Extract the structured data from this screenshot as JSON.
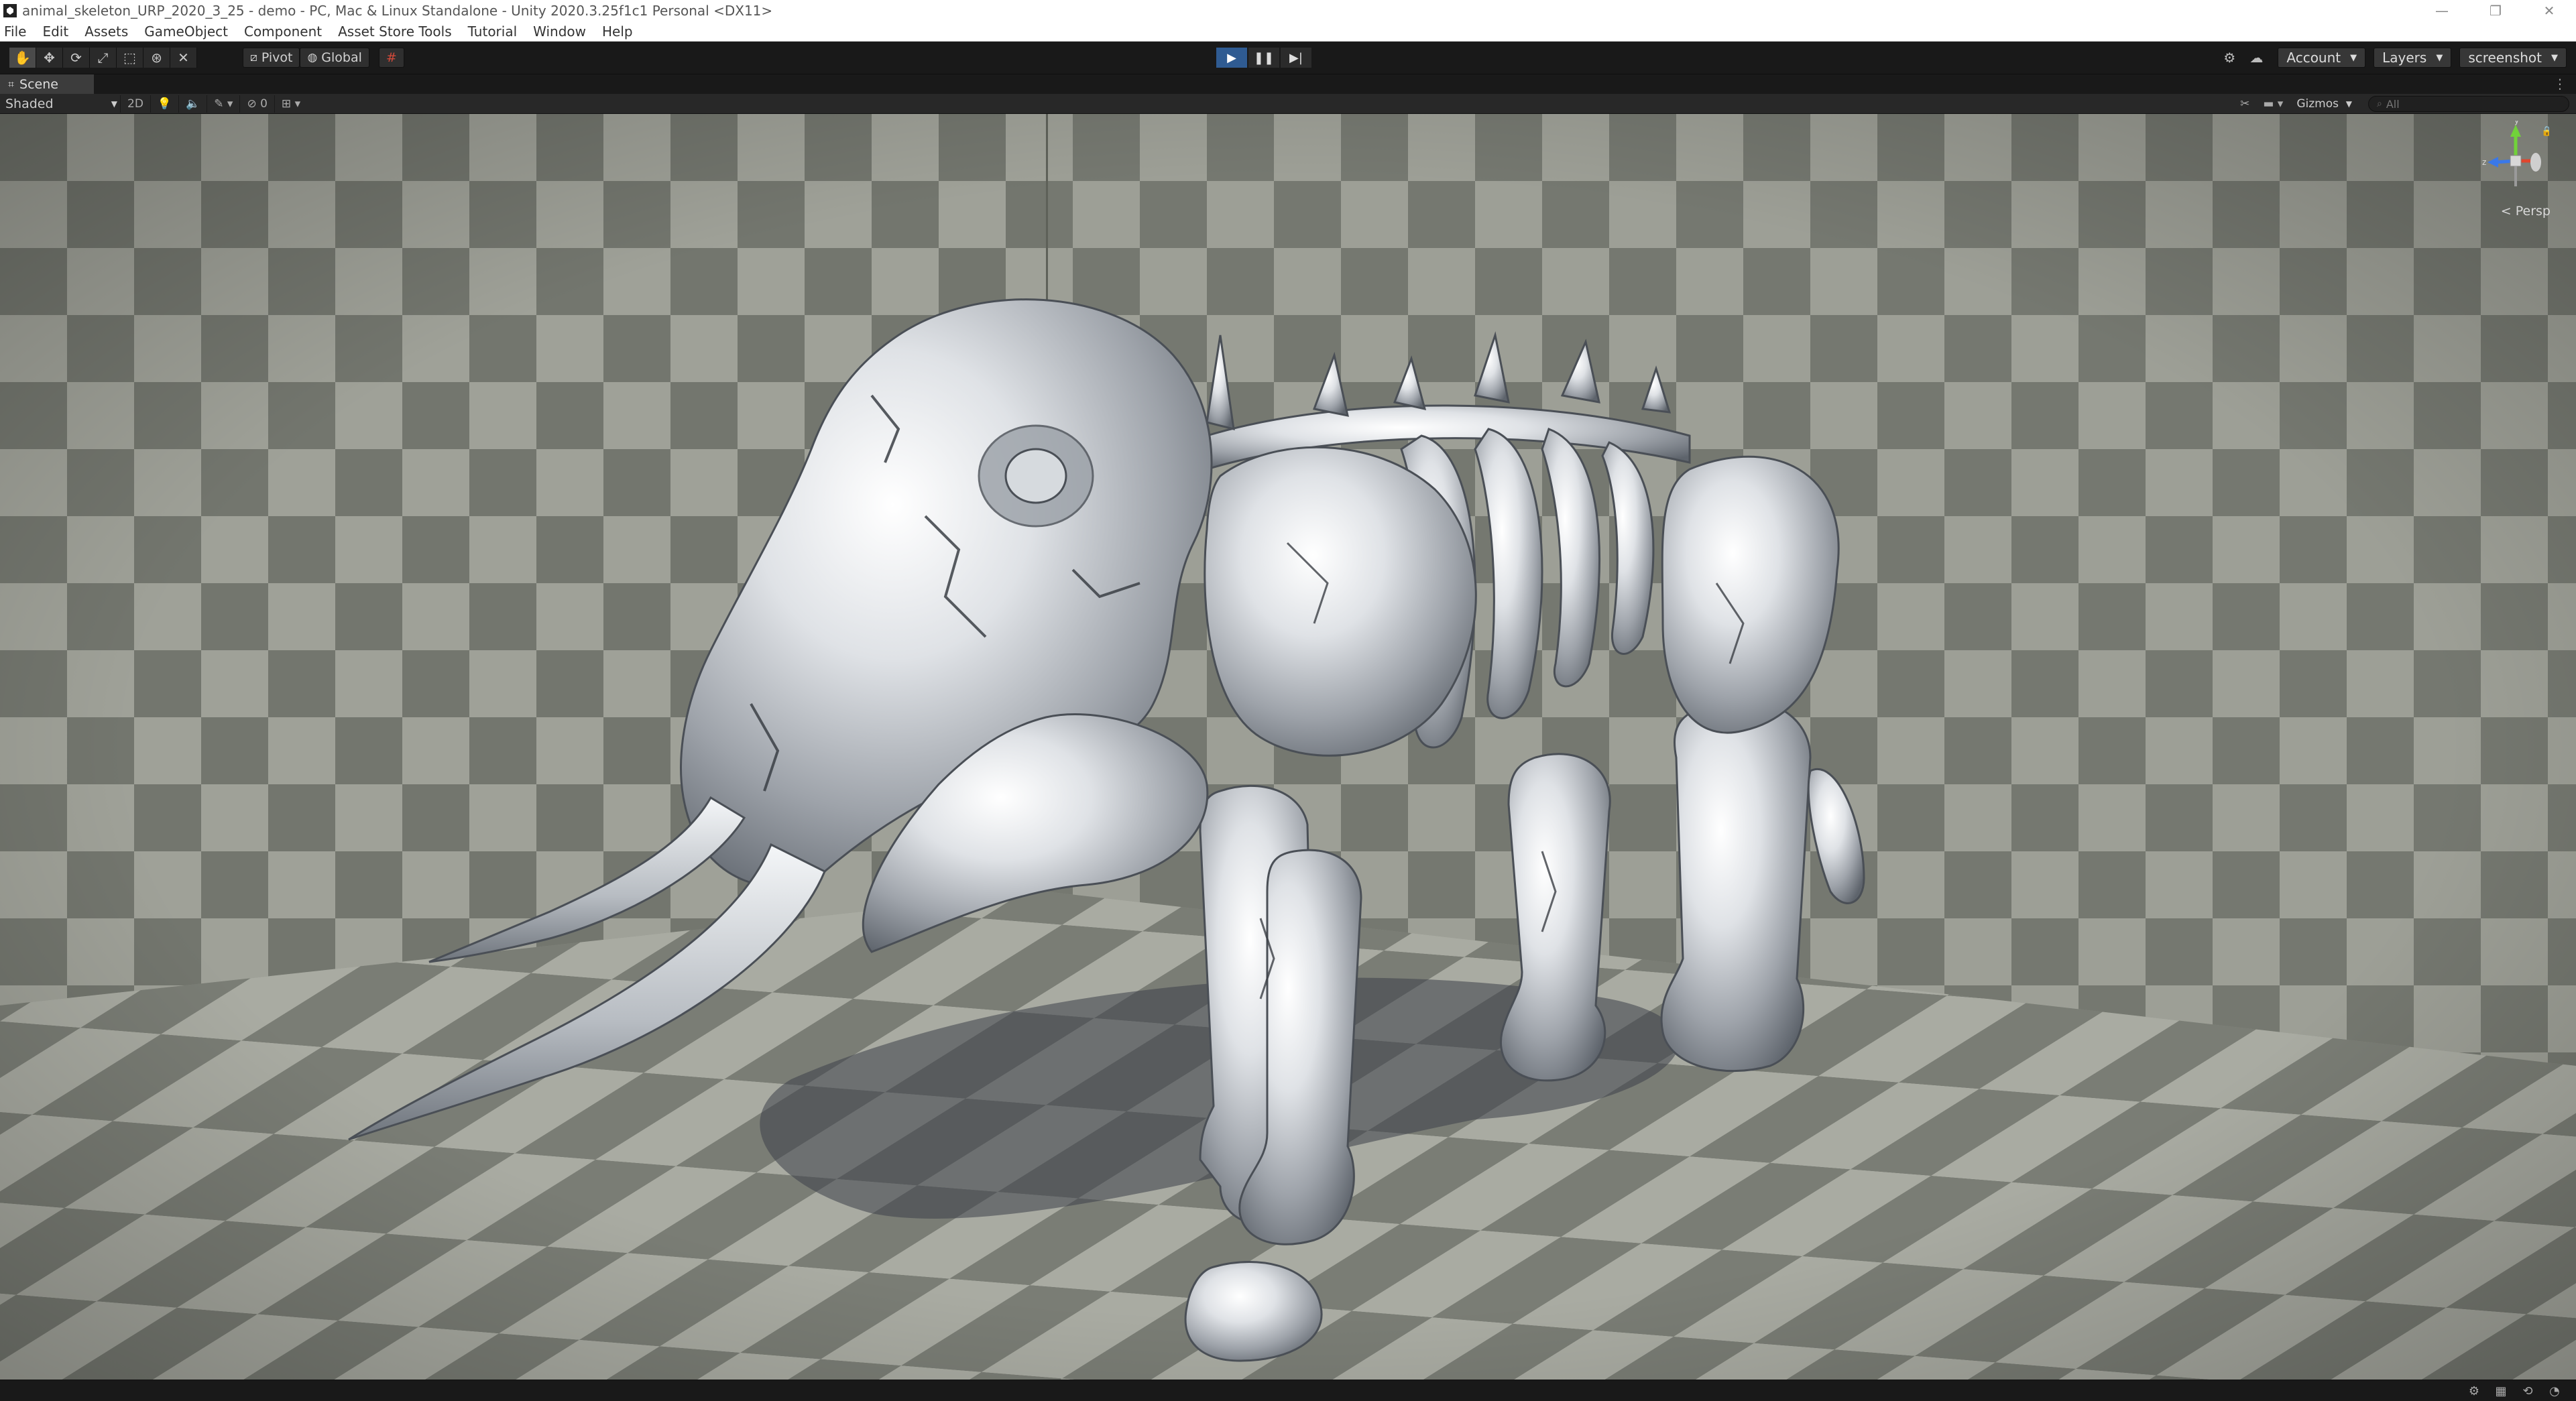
{
  "window": {
    "title": "animal_skeleton_URP_2020_3_25 - demo - PC, Mac & Linux Standalone - Unity 2020.3.25f1c1 Personal <DX11>",
    "controls": [
      "minimize-icon",
      "restore-icon",
      "close-icon"
    ]
  },
  "menu": {
    "items": [
      "File",
      "Edit",
      "Assets",
      "GameObject",
      "Component",
      "Asset Store Tools",
      "Tutorial",
      "Window",
      "Help"
    ]
  },
  "toolbar": {
    "tools": [
      "hand-tool-icon",
      "move-tool-icon",
      "rotate-tool-icon",
      "scale-tool-icon",
      "rect-tool-icon",
      "transform-tool-icon",
      "custom-tool-icon"
    ],
    "pivot_label": "Pivot",
    "global_label": "Global",
    "account_label": "Account",
    "layers_label": "Layers",
    "layout_label": "screenshot"
  },
  "scene": {
    "tab_label": "Scene",
    "shading_mode": "Shaded",
    "mode_2d_label": "2D",
    "hidden_count": "0",
    "gizmos_label": "Gizmos",
    "search_placeholder": "All",
    "projection_label": "< Persp",
    "gizmo_axes": {
      "y": "y",
      "z": "z"
    }
  },
  "colors": {
    "play_active": "#2f5b92",
    "checker_light": "#a6a89f",
    "checker_dark": "#6f726a",
    "bone_base": "#c9ccd0",
    "axis_x": "#e0462e",
    "axis_y": "#71d23a",
    "axis_z": "#3a78e8"
  }
}
